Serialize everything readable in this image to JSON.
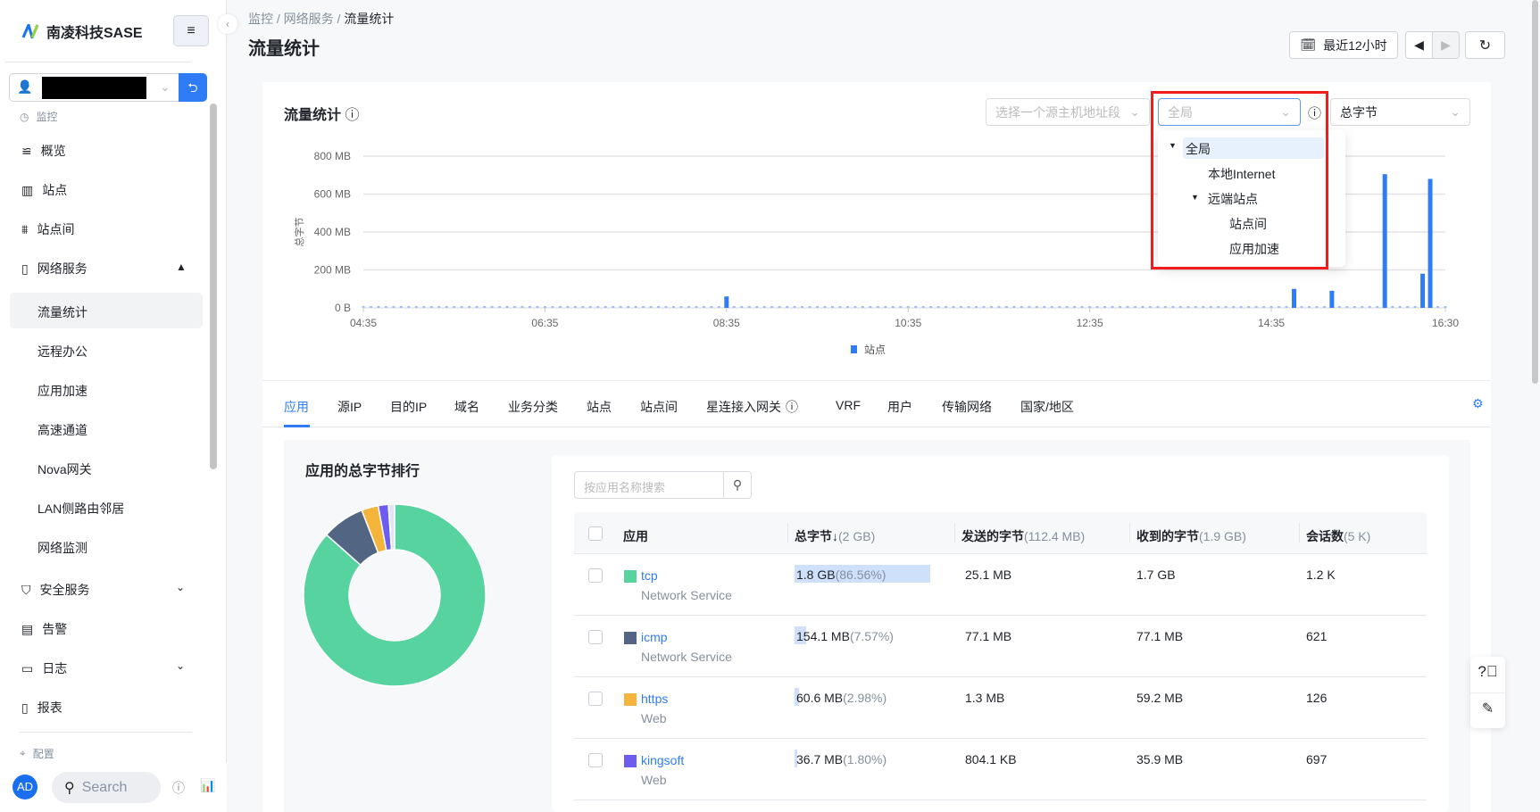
{
  "brand": {
    "name": "南凌科技SASE"
  },
  "sidebar": {
    "account_redacted": true,
    "sections": {
      "monitor": "监控",
      "config": "配置"
    },
    "items": [
      {
        "label": "概览",
        "icon": "overview-icon"
      },
      {
        "label": "站点",
        "icon": "site-icon"
      },
      {
        "label": "站点间",
        "icon": "site-to-site-icon"
      },
      {
        "label": "网络服务",
        "icon": "network-service-icon",
        "expanded": true
      },
      {
        "label": "安全服务",
        "icon": "shield-icon"
      },
      {
        "label": "告警",
        "icon": "alarm-icon"
      },
      {
        "label": "日志",
        "icon": "log-icon"
      },
      {
        "label": "报表",
        "icon": "report-icon"
      }
    ],
    "subitems": [
      "流量统计",
      "远程办公",
      "应用加速",
      "高速通道",
      "Nova网关",
      "LAN侧路由邻居",
      "网络监测"
    ],
    "active": "流量统计",
    "bottom": {
      "avatar": "AD",
      "search_placeholder": "Search"
    }
  },
  "header": {
    "breadcrumb": [
      "监控",
      "网络服务",
      "流量统计"
    ],
    "title": "流量统计",
    "time_range": "最近12小时"
  },
  "chart_card": {
    "title": "流量统计",
    "source_placeholder": "选择一个源主机地址段",
    "scope_value": "全局",
    "metric_value": "总字节",
    "dropdown": [
      "全局",
      "本地Internet",
      "远端站点",
      "站点间",
      "应用加速"
    ]
  },
  "chart_data": {
    "type": "bar",
    "ylabel": "总字节",
    "yticks": [
      "800 MB",
      "600 MB",
      "400 MB",
      "200 MB",
      "0 B"
    ],
    "ylim": [
      0,
      800
    ],
    "unit": "MB",
    "xticks": [
      "04:35",
      "06:35",
      "08:35",
      "10:35",
      "12:35",
      "14:35",
      "16:30"
    ],
    "xrange": [
      "04:35",
      "16:30"
    ],
    "interval_minutes": 5,
    "legend": "站点",
    "legend_position": "bottom",
    "color": "#2f7cf6",
    "grid": true,
    "points": [
      [
        "08:35",
        60
      ],
      [
        "14:50",
        100
      ],
      [
        "15:15",
        90
      ],
      [
        "15:50",
        705
      ],
      [
        "16:15",
        180
      ],
      [
        "16:20",
        680
      ]
    ]
  },
  "tabs": [
    "应用",
    "源IP",
    "目的IP",
    "域名",
    "业务分类",
    "站点",
    "站点间",
    "星连接入网关",
    "VRF",
    "用户",
    "传输网络",
    "国家/地区"
  ],
  "ranking": {
    "title": "应用的总字节排行",
    "search_placeholder": "按应用名称搜索"
  },
  "table": {
    "headers": [
      {
        "label": "应用",
        "extra": ""
      },
      {
        "label": "总字节↓",
        "extra": "(2 GB)"
      },
      {
        "label": "发送的字节",
        "extra": "(112.4 MB)"
      },
      {
        "label": "收到的字节",
        "extra": "(1.9 GB)"
      },
      {
        "label": "会话数",
        "extra": "(5 K)"
      }
    ],
    "rows": [
      {
        "app": "tcp",
        "cat": "Network Service",
        "color": "#57d3a0",
        "total": "1.8 GB",
        "pct": "(86.56%)",
        "share": 86.56,
        "sent": "25.1 MB",
        "recv": "1.7 GB",
        "sessions": "1.2 K"
      },
      {
        "app": "icmp",
        "cat": "Network Service",
        "color": "#526582",
        "total": "154.1 MB",
        "pct": "(7.57%)",
        "share": 7.57,
        "sent": "77.1 MB",
        "recv": "77.1 MB",
        "sessions": "621"
      },
      {
        "app": "https",
        "cat": "Web",
        "color": "#f5b43c",
        "total": "60.6 MB",
        "pct": "(2.98%)",
        "share": 2.98,
        "sent": "1.3 MB",
        "recv": "59.2 MB",
        "sessions": "126"
      },
      {
        "app": "kingsoft",
        "cat": "Web",
        "color": "#6c5cf0",
        "total": "36.7 MB",
        "pct": "(1.80%)",
        "share": 1.8,
        "sent": "804.1 KB",
        "recv": "35.9 MB",
        "sessions": "697"
      }
    ]
  }
}
